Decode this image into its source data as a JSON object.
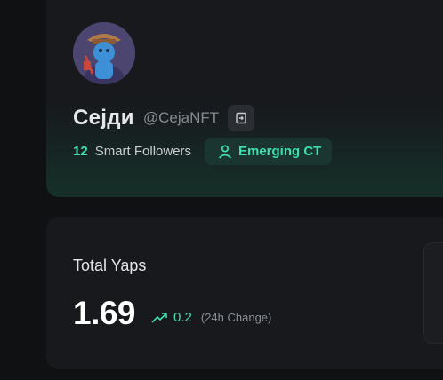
{
  "profile": {
    "display_name": "Сејди",
    "handle": "@CejaNFT",
    "smart_followers_count": "12",
    "smart_followers_label": "Smart Followers",
    "badge_label": "Emerging CT"
  },
  "yaps": {
    "title": "Total Yaps",
    "value": "1.69",
    "change": "0.2",
    "change_period": "(24h Change)"
  },
  "icons": {
    "handle_action": "login-icon",
    "badge": "user-icon",
    "trend": "trending-up-icon"
  },
  "colors": {
    "accent": "#3ee0ae",
    "background": "#101113",
    "card": "#17191c",
    "badge_bg": "#1b3530"
  }
}
